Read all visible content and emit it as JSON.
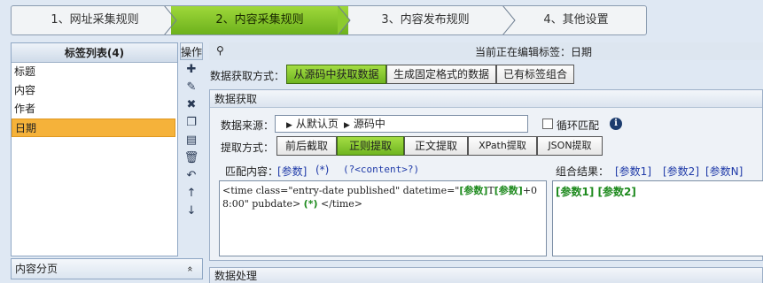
{
  "steps": [
    "1、网址采集规则",
    "2、内容采集规则",
    "3、内容发布规则",
    "4、其他设置"
  ],
  "tag_list": {
    "title": "标签列表(4)",
    "items": [
      "标题",
      "内容",
      "作者",
      "日期"
    ]
  },
  "ops_label": "操作",
  "ops_icons": [
    "add-icon",
    "edit-icon",
    "delete-icon",
    "copy-icon",
    "paste-icon",
    "trash-icon",
    "undo-icon",
    "move-up-icon",
    "move-down-icon"
  ],
  "pagination_panel": {
    "label": "内容分页",
    "chevron": "»"
  },
  "editing_bar": {
    "text": "当前正在编辑标签：日期"
  },
  "fetch_mode": {
    "label": "数据获取方式：",
    "options": [
      "从源码中获取数据",
      "生成固定格式的数据",
      "已有标签组合"
    ]
  },
  "data_fetch": {
    "title": "数据获取",
    "source_label": "数据来源：",
    "source_path": [
      "从默认页",
      "源码中"
    ],
    "loop_match_label": "循环匹配",
    "method_label": "提取方式：",
    "methods": [
      "前后截取",
      "正则提取",
      "正文提取",
      "XPath提取",
      "JSON提取"
    ],
    "match_label": "匹配内容：",
    "match_tokens": [
      "[参数]",
      "(*)",
      "(?<content>?)"
    ],
    "match_content_pre": "<time class=\"entry-date published\" datetime=\"",
    "match_content_p1": "[参数]",
    "match_content_t": "T",
    "match_content_p2": "[参数]",
    "match_content_mid": "+08:00\" pubdate>",
    "match_content_star": "(*)",
    "match_content_post": " </time>",
    "result_label": "组合结果：",
    "result_tokens": [
      "[参数1]",
      "[参数2]",
      "[参数N]"
    ],
    "result_value": "[参数1] [参数2]"
  },
  "data_processing": {
    "title": "数据处理"
  },
  "colors": {
    "active_step": "#8ccb2e",
    "selected_tag": "#f5b23a",
    "param_green": "#1e8a1e",
    "token_blue": "#1f3aa8"
  }
}
